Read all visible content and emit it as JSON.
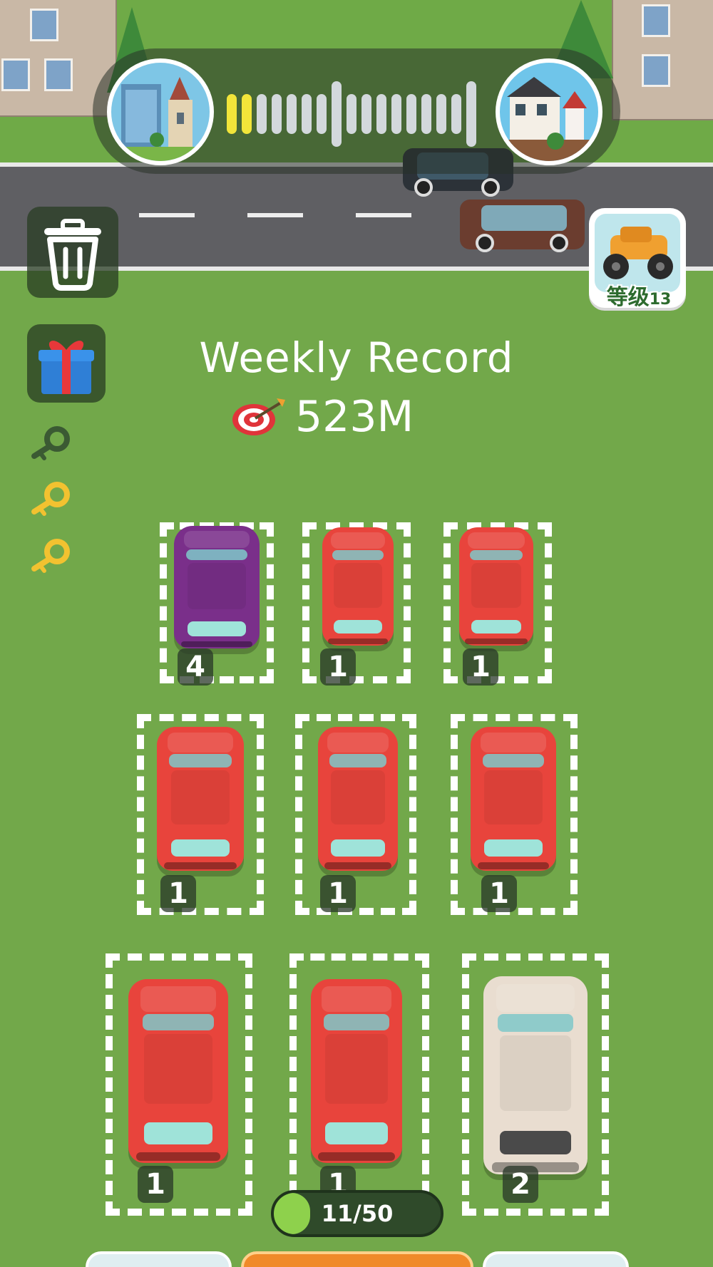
{
  "hud": {
    "city_progress_ticks": {
      "filled": 2,
      "total": 17
    },
    "origin_city_icon": "city-skyline-icon",
    "destination_city_icon": "village-house-icon"
  },
  "side_buttons": {
    "trash_icon": "trash-can-icon",
    "gift_icon": "gift-box-icon",
    "keys": [
      {
        "icon": "key-icon",
        "collected": false
      },
      {
        "icon": "key-icon",
        "collected": true
      },
      {
        "icon": "key-icon",
        "collected": true
      }
    ]
  },
  "level_badge": {
    "label": "等级",
    "level": "13",
    "icon": "monster-truck-icon"
  },
  "weekly_record": {
    "title": "Weekly Record",
    "value": "523M",
    "icon": "target-icon"
  },
  "parking": {
    "slots": [
      {
        "car_color": "#7a2f8a",
        "car_type": "sports",
        "level": "4"
      },
      {
        "car_color": "#e8443c",
        "car_type": "suv",
        "level": "1"
      },
      {
        "car_color": "#e8443c",
        "car_type": "suv",
        "level": "1"
      },
      {
        "car_color": "#e8443c",
        "car_type": "suv",
        "level": "1"
      },
      {
        "car_color": "#e8443c",
        "car_type": "suv",
        "level": "1"
      },
      {
        "car_color": "#e8443c",
        "car_type": "suv",
        "level": "1"
      },
      {
        "car_color": "#e8443c",
        "car_type": "suv",
        "level": "1"
      },
      {
        "car_color": "#e8443c",
        "car_type": "suv",
        "level": "1"
      },
      {
        "car_color": "#e9ddd0",
        "car_type": "sedan",
        "level": "2"
      }
    ]
  },
  "capacity": {
    "label": "11/50",
    "current": 11,
    "max": 50
  },
  "colors": {
    "grass": "#72a84a",
    "road": "#5f5f63",
    "tick_filled": "#f2e53a",
    "tick_empty": "#d3d8dc",
    "counter_fill": "#8ed14c"
  }
}
